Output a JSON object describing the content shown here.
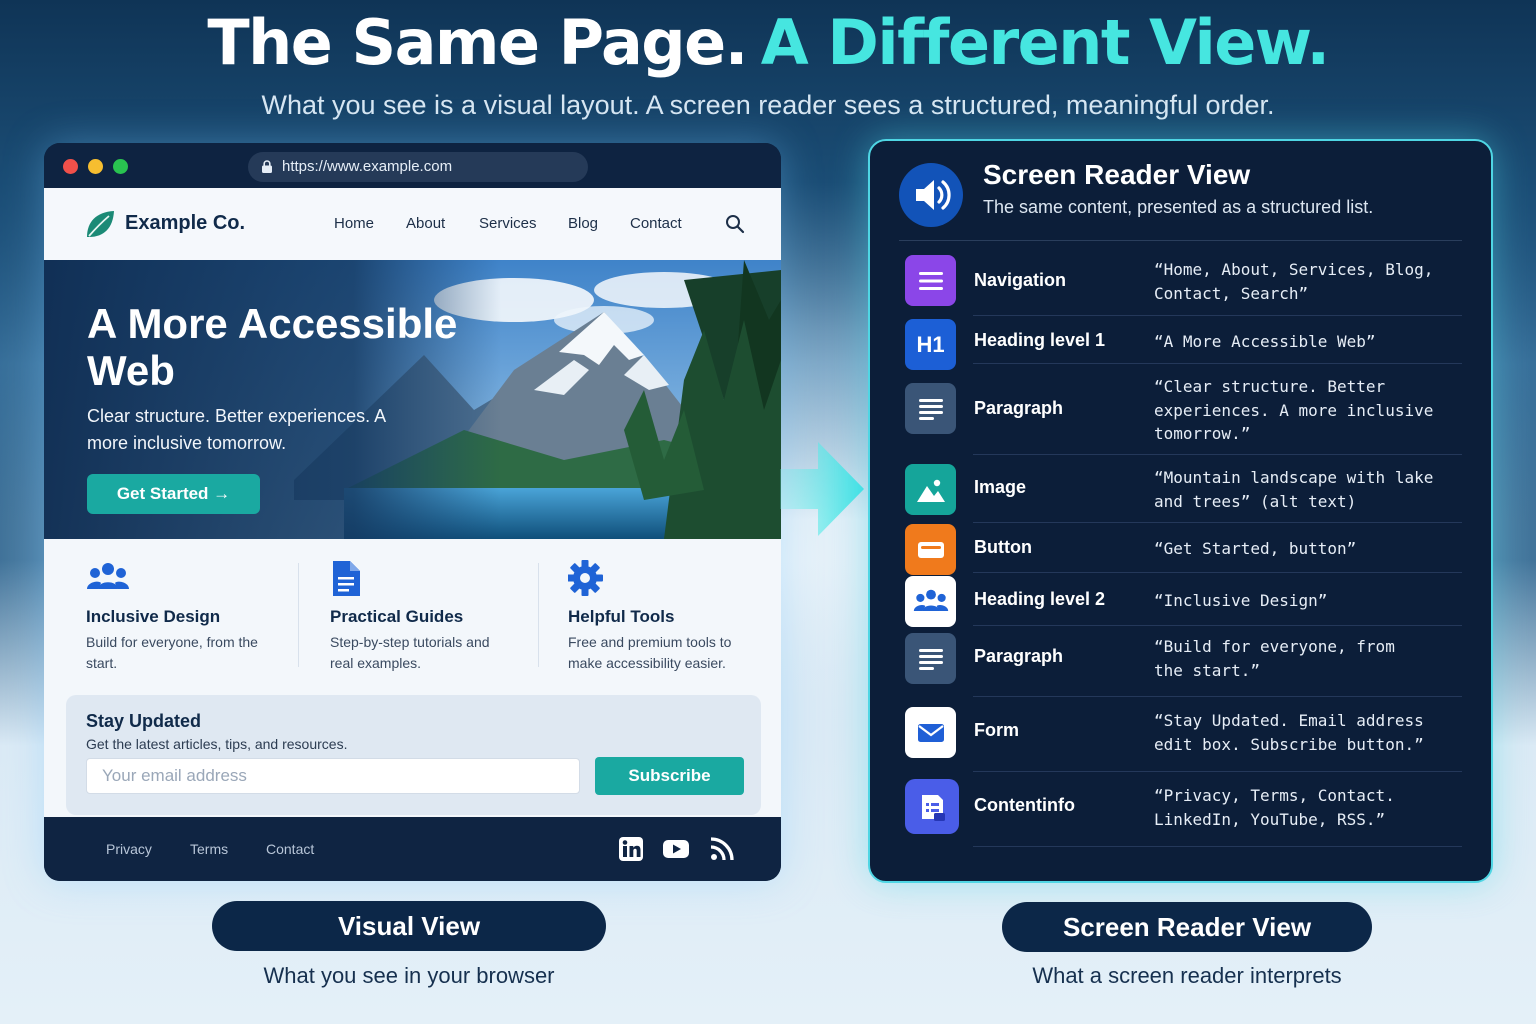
{
  "headline": {
    "part1": "The Same Page.",
    "part2": "A Different View.",
    "subtitle": "What you see is a visual layout. A screen reader sees a structured, meaningful order."
  },
  "browser": {
    "url": "https://www.example.com",
    "logo_text": "Example Co.",
    "nav": [
      "Home",
      "About",
      "Services",
      "Blog",
      "Contact"
    ],
    "hero": {
      "title": "A More Accessible Web",
      "subtitle": "Clear structure. Better experiences. A more inclusive tomorrow.",
      "button_label": "Get Started →"
    },
    "features": [
      {
        "title": "Inclusive Design",
        "desc": "Build for everyone, from the start.",
        "icon": "users-icon"
      },
      {
        "title": "Practical Guides",
        "desc": "Step-by-step tutorials and real examples.",
        "icon": "document-icon"
      },
      {
        "title": "Helpful Tools",
        "desc": "Free and premium tools to make accessibility easier.",
        "icon": "gear-icon"
      }
    ],
    "newsletter": {
      "title": "Stay Updated",
      "desc": "Get the latest articles, tips, and resources.",
      "placeholder": "Your email address",
      "button_label": "Subscribe"
    },
    "footer": {
      "links": [
        "Privacy",
        "Terms",
        "Contact"
      ],
      "social": [
        "linkedin-icon",
        "youtube-icon",
        "rss-icon"
      ]
    }
  },
  "screen_reader": {
    "title": "Screen Reader View",
    "subtitle": "The same content, presented as a structured list.",
    "rows": [
      {
        "label": "Navigation",
        "value": "“Home, About, Services, Blog,\nContact, Search”",
        "icon": "list-icon",
        "color": "#8b46e8"
      },
      {
        "label": "Heading level 1",
        "value": "“A More Accessible Web”",
        "icon": "h1-icon",
        "icon_text": "H1",
        "color": "#1c5fd6"
      },
      {
        "label": "Paragraph",
        "value": "“Clear structure. Better\nexperiences. A more inclusive\ntomorrow.”",
        "icon": "paragraph-icon",
        "color": "#3a5577"
      },
      {
        "label": "Image",
        "value": "“Mountain landscape with lake\nand trees” (alt text)",
        "icon": "image-icon",
        "color": "#15a59a"
      },
      {
        "label": "Button",
        "value": "“Get Started, button”",
        "icon": "button-icon",
        "color": "#f07a1c"
      },
      {
        "label": "Heading level 2",
        "value": "“Inclusive Design”",
        "icon": "users-icon",
        "color": "#ffffff"
      },
      {
        "label": "Paragraph",
        "value": "“Build for everyone, from\nthe start.”",
        "icon": "paragraph-icon",
        "color": "#3a5577"
      },
      {
        "label": "Form",
        "value": "“Stay Updated. Email address\nedit box. Subscribe button.”",
        "icon": "envelope-icon",
        "color": "#ffffff"
      },
      {
        "label": "Contentinfo",
        "value": "“Privacy, Terms, Contact.\nLinkedIn, YouTube, RSS.”",
        "icon": "footer-icon",
        "color": "#4a5de8"
      }
    ]
  },
  "labels": {
    "visual_pill": "Visual View",
    "visual_caption": "What you see in your browser",
    "sr_pill": "Screen Reader View",
    "sr_caption": "What a screen reader interprets"
  },
  "colors": {
    "accent_cyan": "#46e6e0",
    "teal_button": "#1aa9a1",
    "navy": "#0c1e39"
  }
}
